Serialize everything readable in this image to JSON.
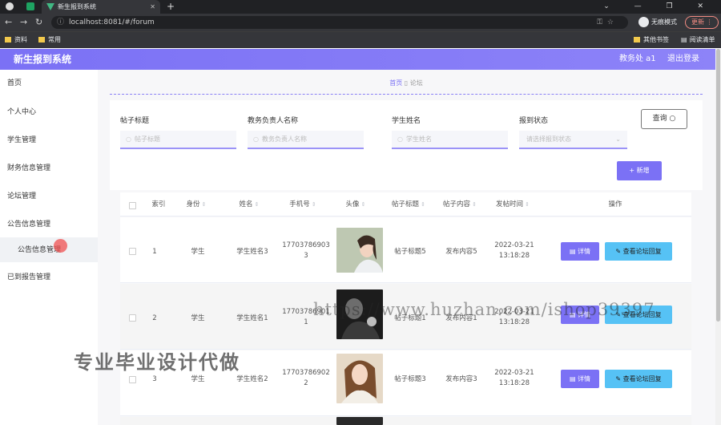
{
  "browser": {
    "active_tab_title": "新生报到系统",
    "url": "localhost:8081/#/forum",
    "incognito_label": "无痕模式",
    "update_label": "更新",
    "bookmarks": [
      "资料",
      "常用"
    ],
    "bookmarks_right": [
      "其他书签",
      "阅读清单"
    ]
  },
  "header": {
    "title": "新生报到系统",
    "user": "教务处 a1",
    "logout": "退出登录",
    "accent_color": "#7b71f5"
  },
  "sidebar": {
    "items": [
      "首页",
      "个人中心",
      "学生管理",
      "财务信息管理",
      "论坛管理",
      "公告信息管理"
    ],
    "sub_item": "公告信息管理",
    "last_item": "已到报告管理"
  },
  "breadcrumb": {
    "home": "首页",
    "current": "论坛"
  },
  "search": {
    "labels": [
      "帖子标题",
      "教务负责人名称",
      "学生姓名",
      "报到状态"
    ],
    "placeholders": [
      "帖子标题",
      "教务负责人名称",
      "学生姓名"
    ],
    "select_placeholder": "请选择报到状态",
    "query_label": "查询",
    "add_label": "新增"
  },
  "table": {
    "headers": [
      "索引",
      "身份",
      "姓名",
      "手机号",
      "头像",
      "帖子标题",
      "帖子内容",
      "发帖时间",
      "操作"
    ],
    "detail_label": "详情",
    "view_label": "查看论坛回复",
    "rows": [
      {
        "index": "1",
        "role": "学生",
        "name": "学生姓名3",
        "phone_a": "17703786903",
        "phone_b": "3",
        "title": "帖子标题5",
        "content": "发布内容5",
        "date": "2022-03-21",
        "time": "13:18:28"
      },
      {
        "index": "2",
        "role": "学生",
        "name": "学生姓名1",
        "phone_a": "17703786901",
        "phone_b": "1",
        "title": "帖子标题1",
        "content": "发布内容1",
        "date": "2022-03-21",
        "time": "13:18:28"
      },
      {
        "index": "3",
        "role": "学生",
        "name": "学生姓名2",
        "phone_a": "17703786902",
        "phone_b": "2",
        "title": "帖子标题3",
        "content": "发布内容3",
        "date": "2022-03-21",
        "time": "13:18:28"
      }
    ]
  },
  "watermark": "https://www.huzhan.com/ishop39397",
  "overlay_text": "专业毕业设计代做"
}
